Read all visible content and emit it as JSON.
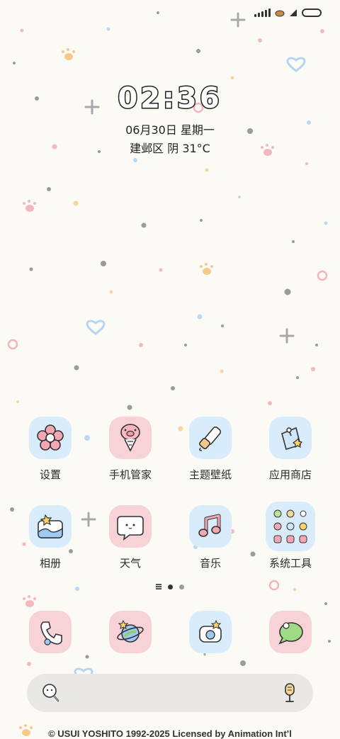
{
  "status_bar": {
    "icons": [
      "signal-icon",
      "carrier-icon",
      "wifi-icon",
      "battery-icon"
    ]
  },
  "lockscreen": {
    "time": "02:36",
    "date": "06月30日 星期一",
    "weather": "建邺区 阴 31°C"
  },
  "apps_row1": [
    {
      "label": "设置",
      "icon": "flower-icon",
      "bg": "blue"
    },
    {
      "label": "手机管家",
      "icon": "pig-balloon-icon",
      "bg": "pink"
    },
    {
      "label": "主题壁纸",
      "icon": "paintbrush-icon",
      "bg": "blue"
    },
    {
      "label": "应用商店",
      "icon": "gift-bag-icon",
      "bg": "blue"
    }
  ],
  "apps_row2": [
    {
      "label": "相册",
      "icon": "photo-album-icon",
      "bg": "blue"
    },
    {
      "label": "天气",
      "icon": "speech-bubble-face-icon",
      "bg": "pink"
    },
    {
      "label": "音乐",
      "icon": "music-note-icon",
      "bg": "blue"
    },
    {
      "label": "系统工具",
      "icon": "folder-grid-icon",
      "bg": "blue"
    }
  ],
  "dock": [
    {
      "icon": "phone-icon",
      "bg": "pink"
    },
    {
      "icon": "planet-browser-icon",
      "bg": "pink"
    },
    {
      "icon": "camera-icon",
      "bg": "blue"
    },
    {
      "icon": "message-bubble-icon",
      "bg": "pink"
    }
  ],
  "pager": {
    "pages": 2,
    "active": 1
  },
  "search": {
    "left_icon": "search-face-icon",
    "right_icon": "microphone-icon"
  },
  "copyright": "© USUI YOSHITO 1992-2025 Licensed by Animation Int’l",
  "colors": {
    "background": "#fbfaf5",
    "tile_blue": "#d9ecfb",
    "tile_pink": "#f7d2d6",
    "search_bar": "#e9e8e4"
  }
}
